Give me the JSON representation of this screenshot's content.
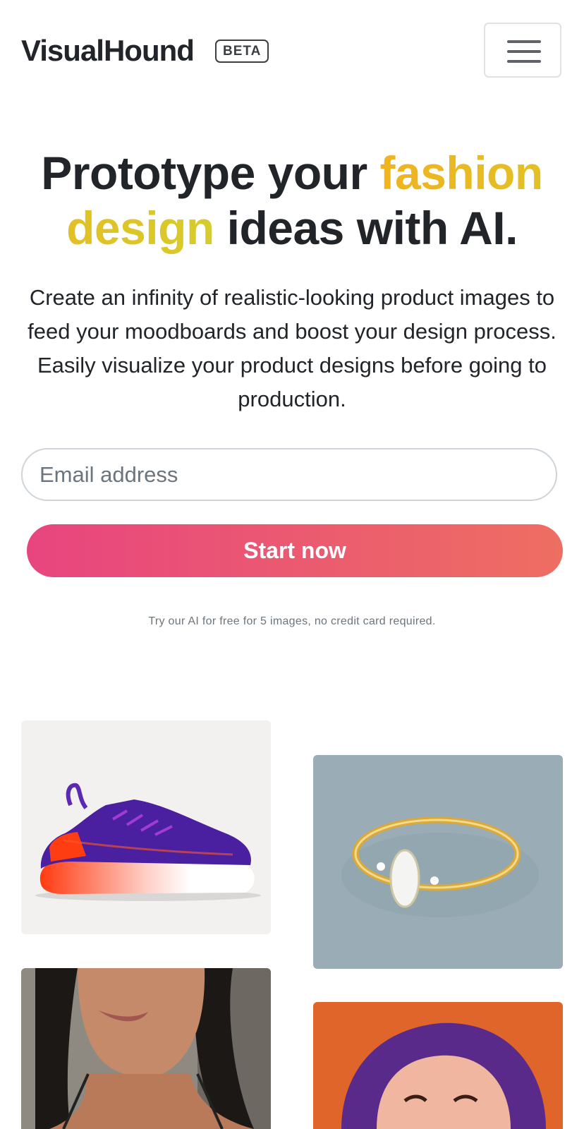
{
  "header": {
    "logo": "VisualHound",
    "badge": "BETA",
    "menu_icon": "hamburger-icon"
  },
  "hero": {
    "title_part1": "Prototype your ",
    "title_accent": "fashion design",
    "title_part2": " ideas with AI.",
    "subtitle": "Create an infinity of realistic-looking product images to feed your moodboards and boost your design process. Easily visualize your product designs before going to production."
  },
  "signup": {
    "email_placeholder": "Email address",
    "email_value": "",
    "cta_label": "Start now",
    "note": "Try our AI for free for 5 images, no credit card required."
  },
  "colors": {
    "accent_start": "#f0b31f",
    "accent_end": "#d6cc2a",
    "cta_start": "#e8457f",
    "cta_end": "#ee6e62"
  },
  "gallery": [
    {
      "subject": "sneaker"
    },
    {
      "subject": "ring"
    },
    {
      "subject": "woman-portrait"
    },
    {
      "subject": "woman-purple-hair"
    }
  ]
}
